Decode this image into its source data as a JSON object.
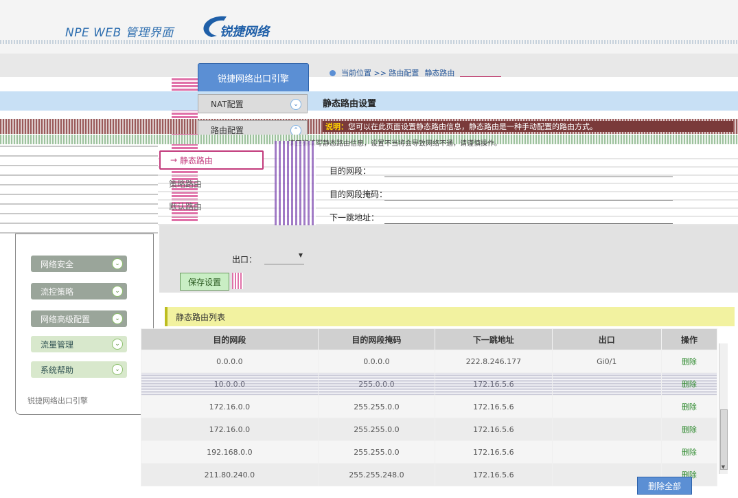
{
  "header": {
    "brand_text": "NPE WEB 管理界面",
    "logo_text": "锐捷网络"
  },
  "engine_button": "锐捷网络出口引擎",
  "breadcrumb": {
    "current_position": "当前位置 >> 路由配置",
    "page": "静态路由"
  },
  "menu": {
    "nat": "NAT配置",
    "routing": "路由配置"
  },
  "section_title": "静态路由设置",
  "alert": {
    "prefix": "说明：",
    "text": "您可以在此页面设置静态路由信息，静态路由是一种手动配置的路由方式。"
  },
  "note": "请正确填写静态路由信息，设置不当将会导致网络不通，请谨慎操作。",
  "submenu": {
    "static_route": "静态路由",
    "item2": "策略路由",
    "item3": "默认路由"
  },
  "form": {
    "dest_net_label": "目的网段：",
    "mask_label": "目的网段掩码：",
    "next_hop_label": "下一跳地址：",
    "exit_label": "出口：",
    "save_button": "保存设置"
  },
  "left_nav": {
    "items": [
      {
        "label": "网络安全"
      },
      {
        "label": "流控策略"
      },
      {
        "label": "网络高级配置"
      },
      {
        "label": "流量管理"
      },
      {
        "label": "系统帮助"
      }
    ],
    "footer": "锐捷网络出口引擎"
  },
  "list_title": "静态路由列表",
  "table": {
    "headers": [
      "目的网段",
      "目的网段掩码",
      "下一跳地址",
      "出口",
      "操作"
    ],
    "rows": [
      {
        "dest": "0.0.0.0",
        "mask": "0.0.0.0",
        "next": "222.8.246.177",
        "port": "Gi0/1",
        "op": "删除"
      },
      {
        "dest": "10.0.0.0",
        "mask": "255.0.0.0",
        "next": "172.16.5.6",
        "port": "",
        "op": "删除"
      },
      {
        "dest": "172.16.0.0",
        "mask": "255.255.0.0",
        "next": "172.16.5.6",
        "port": "",
        "op": "删除"
      },
      {
        "dest": "172.16.0.0",
        "mask": "255.255.0.0",
        "next": "172.16.5.6",
        "port": "",
        "op": "删除"
      },
      {
        "dest": "192.168.0.0",
        "mask": "255.255.0.0",
        "next": "172.16.5.6",
        "port": "",
        "op": "删除"
      },
      {
        "dest": "211.80.240.0",
        "mask": "255.255.248.0",
        "next": "172.16.5.6",
        "port": "",
        "op": "删除"
      }
    ]
  },
  "delete_all_button": "删除全部"
}
